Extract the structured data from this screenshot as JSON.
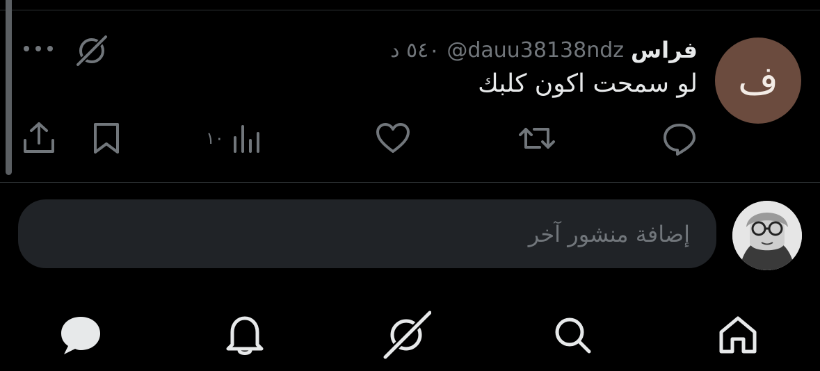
{
  "tweet": {
    "avatar_letter": "ف",
    "display_name": "فراس",
    "handle": "@dauu38138ndz",
    "time_ago": "٥٤٠ د",
    "text": "لو سمحت اكون كلبك",
    "views": "١٠"
  },
  "icons": {
    "more": "more-horizontal-icon",
    "grok": "grok-icon",
    "reply": "reply-icon",
    "retweet": "retweet-icon",
    "like": "heart-icon",
    "views": "views-chart-icon",
    "bookmark": "bookmark-icon",
    "share": "share-icon"
  },
  "composer": {
    "placeholder": "إضافة منشور آخر"
  },
  "tabbar": [
    "home-icon",
    "search-icon",
    "grok-icon",
    "notifications-icon",
    "messages-icon"
  ],
  "colors": {
    "background": "#000000",
    "text_primary": "#e7e9ea",
    "text_secondary": "#71767b",
    "avatar_bg": "#6b4b3e",
    "input_bg": "#202327"
  }
}
